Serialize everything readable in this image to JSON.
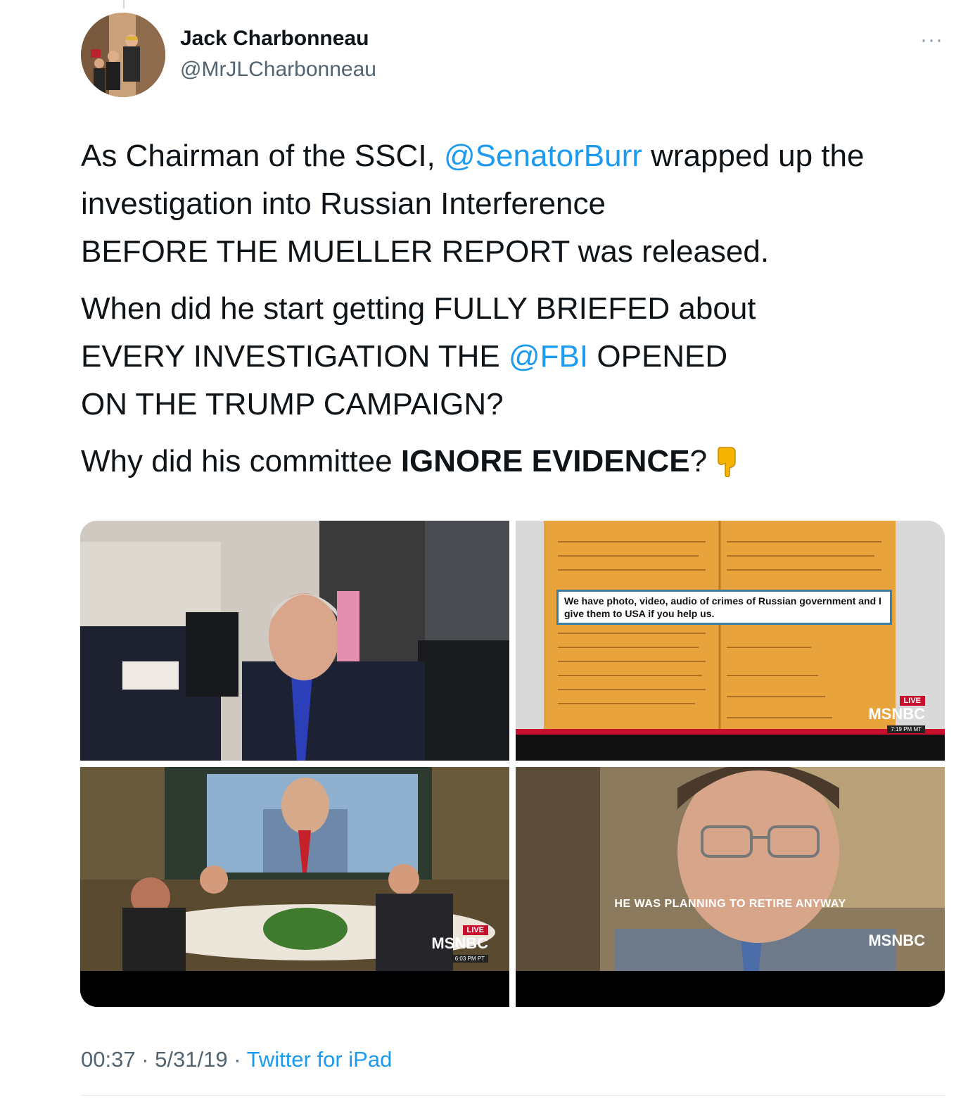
{
  "author": {
    "name": "Jack Charbonneau",
    "handle": "@MrJLCharbonneau"
  },
  "menu": {
    "more_label": "···"
  },
  "tweet": {
    "p1_before": "As Chairman of the SSCI, ",
    "p1_mention": "@SenatorBurr",
    "p1_line1_after": " wrapped up the",
    "p1_line2": "investigation into Russian Interference",
    "p1_line3": "BEFORE THE MUELLER REPORT was released.",
    "p2_line1": "When did he start getting FULLY BRIEFED about",
    "p2_line2_before": "EVERY INVESTIGATION THE ",
    "p2_mention": "@FBI",
    "p2_line2_after": " OPENED",
    "p2_line3": "ON THE TRUMP CAMPAIGN?",
    "p3_before": "Why did his committee ",
    "p3_bold": "IGNORE EVIDENCE",
    "p3_after": "?"
  },
  "media": {
    "tile2_caption": "We have photo, video, audio of crimes of Russian government and I give them to USA if you help us.",
    "tile4_subtitle": "HE WAS PLANNING TO RETIRE ANYWAY",
    "live_label": "LIVE",
    "network_label": "MSNBC",
    "tile2_time": "7:19 PM MT",
    "tile3_time": "6:03 PM PT"
  },
  "meta": {
    "time": "00:37",
    "separator": " · ",
    "date": "5/31/19",
    "source": "Twitter for iPad"
  },
  "colors": {
    "link": "#1d9bf0",
    "secondary_text": "#536471",
    "msnbc_red": "#c8102e"
  },
  "icons": [
    "more-icon",
    "pointing-down-emoji",
    "avatar"
  ]
}
